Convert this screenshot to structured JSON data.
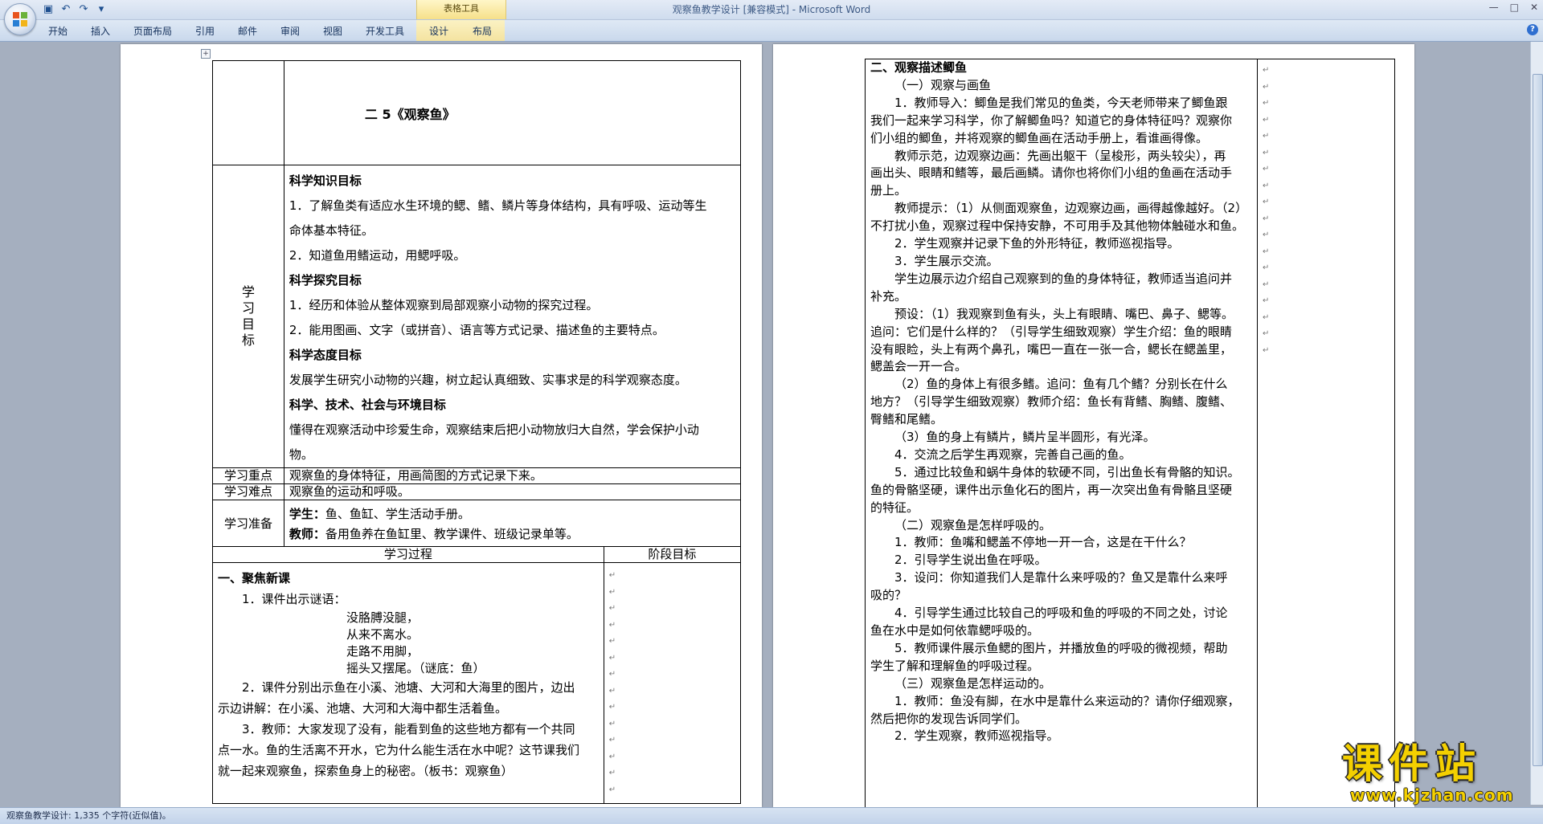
{
  "window": {
    "title": "观察鱼教学设计 [兼容模式] - Microsoft Word"
  },
  "ribbon": {
    "context_group": "表格工具",
    "tabs": [
      "开始",
      "插入",
      "页面布局",
      "引用",
      "邮件",
      "审阅",
      "视图",
      "开发工具",
      "设计",
      "布局"
    ]
  },
  "status": {
    "text": "观察鱼教学设计: 1,335 个字符(近似值)。"
  },
  "watermark": {
    "text": "课件站",
    "url": "www.kjzhan.com"
  },
  "left_page": {
    "lesson_title": "二 5《观察鱼》",
    "goals_label": [
      "学",
      "习",
      "目",
      "标"
    ],
    "goals": [
      {
        "t": "h",
        "s": "科学知识目标"
      },
      {
        "t": "p",
        "s": "1．了解鱼类有适应水生环境的鳃、鳍、鳞片等身体结构，具有呼吸、运动等生"
      },
      {
        "t": "p",
        "s": "命体基本特征。"
      },
      {
        "t": "p",
        "s": "2．知道鱼用鳍运动，用鳃呼吸。"
      },
      {
        "t": "h",
        "s": "科学探究目标"
      },
      {
        "t": "p",
        "s": "1．经历和体验从整体观察到局部观察小动物的探究过程。"
      },
      {
        "t": "p",
        "s": "2．能用图画、文字（或拼音）、语言等方式记录、描述鱼的主要特点。"
      },
      {
        "t": "h",
        "s": "科学态度目标"
      },
      {
        "t": "p",
        "s": "发展学生研究小动物的兴趣，树立起认真细致、实事求是的科学观察态度。"
      },
      {
        "t": "h",
        "s": "科学、技术、社会与环境目标"
      },
      {
        "t": "p",
        "s": "懂得在观察活动中珍爱生命，观察结束后把小动物放归大自然，学会保护小动"
      },
      {
        "t": "p",
        "s": "物。"
      }
    ],
    "key_label": "学习重点",
    "key_text": "观察鱼的身体特征，用画简图的方式记录下来。",
    "diff_label": "学习难点",
    "diff_text": "观察鱼的运动和呼吸。",
    "prep_label": "学习准备",
    "prep_student_label": "学生：",
    "prep_student": "鱼、鱼缸、学生活动手册。",
    "prep_teacher_label": "教师：",
    "prep_teacher": "备用鱼养在鱼缸里、教学课件、班级记录单等。",
    "process_header": "学习过程",
    "stage_header": "阶段目标",
    "process": [
      {
        "t": "h",
        "s": "一、聚焦新课"
      },
      {
        "t": "p",
        "s": "1．课件出示谜语："
      },
      {
        "t": "r",
        "s": "没胳膊没腿，"
      },
      {
        "t": "r",
        "s": "从来不离水。"
      },
      {
        "t": "r",
        "s": "走路不用脚，"
      },
      {
        "t": "r",
        "s": "摇头又摆尾。（谜底：鱼）"
      },
      {
        "t": "p",
        "s": "2．课件分别出示鱼在小溪、池塘、大河和大海里的图片，边出"
      },
      {
        "t": "c",
        "s": "示边讲解：在小溪、池塘、大河和大海中都生活着鱼。"
      },
      {
        "t": "p",
        "s": "3．教师：大家发现了没有，能看到鱼的这些地方都有一个共同"
      },
      {
        "t": "c",
        "s": "点一水。鱼的生活离不开水，它为什么能生活在水中呢？这节课我们"
      },
      {
        "t": "c",
        "s": "就一起来观察鱼，探索鱼身上的秘密。（板书：观察鱼）"
      }
    ]
  },
  "right_page": {
    "lines": [
      {
        "t": "h",
        "s": "二、观察描述鲫鱼"
      },
      {
        "t": "p",
        "s": "（一）观察与画鱼"
      },
      {
        "t": "p",
        "s": "1．教师导入：鲫鱼是我们常见的鱼类，今天老师带来了鲫鱼跟"
      },
      {
        "t": "c",
        "s": "我们一起来学习科学，你了解鲫鱼吗？知道它的身体特征吗？观察你"
      },
      {
        "t": "c",
        "s": "们小组的鲫鱼，并将观察的鲫鱼画在活动手册上，看谁画得像。"
      },
      {
        "t": "p",
        "s": "教师示范，边观察边画：先画出躯干（呈梭形，两头较尖），再"
      },
      {
        "t": "c",
        "s": "画出头、眼睛和鳍等，最后画鳞。请你也将你们小组的鱼画在活动手"
      },
      {
        "t": "c",
        "s": "册上。"
      },
      {
        "t": "p",
        "s": "教师提示：（1）从侧面观察鱼，边观察边画，画得越像越好。（2）"
      },
      {
        "t": "c",
        "s": "不打扰小鱼，观察过程中保持安静，不可用手及其他物体触碰水和鱼。"
      },
      {
        "t": "p",
        "s": "2．学生观察并记录下鱼的外形特征，教师巡视指导。"
      },
      {
        "t": "p",
        "s": "3．学生展示交流。"
      },
      {
        "t": "p",
        "s": "学生边展示边介绍自己观察到的鱼的身体特征，教师适当追问并"
      },
      {
        "t": "c",
        "s": "补充。"
      },
      {
        "t": "p",
        "s": "预设：（1）我观察到鱼有头，头上有眼睛、嘴巴、鼻子、鳃等。"
      },
      {
        "t": "c",
        "s": "追问：它们是什么样的？（引导学生细致观察）学生介绍：鱼的眼睛"
      },
      {
        "t": "c",
        "s": "没有眼睑，头上有两个鼻孔，嘴巴一直在一张一合，鳃长在鳃盖里，"
      },
      {
        "t": "c",
        "s": "鳃盖会一开一合。"
      },
      {
        "t": "p",
        "s": "（2）鱼的身体上有很多鳍。追问：鱼有几个鳍？分别长在什么"
      },
      {
        "t": "c",
        "s": "地方？（引导学生细致观察）教师介绍：鱼长有背鳍、胸鳍、腹鳍、"
      },
      {
        "t": "c",
        "s": "臀鳍和尾鳍。"
      },
      {
        "t": "p",
        "s": "（3）鱼的身上有鳞片，鳞片呈半圆形，有光泽。"
      },
      {
        "t": "p",
        "s": "4．交流之后学生再观察，完善自己画的鱼。"
      },
      {
        "t": "p",
        "s": "5．通过比较鱼和蜗牛身体的软硬不同，引出鱼长有骨骼的知识。"
      },
      {
        "t": "c",
        "s": "鱼的骨骼坚硬，课件出示鱼化石的图片，再一次突出鱼有骨骼且坚硬"
      },
      {
        "t": "c",
        "s": "的特征。"
      },
      {
        "t": "p",
        "s": "（二）观察鱼是怎样呼吸的。"
      },
      {
        "t": "p",
        "s": "1．教师：鱼嘴和鳃盖不停地一开一合，这是在干什么？"
      },
      {
        "t": "p",
        "s": "2．引导学生说出鱼在呼吸。"
      },
      {
        "t": "p",
        "s": "3．设问：你知道我们人是靠什么来呼吸的？鱼又是靠什么来呼"
      },
      {
        "t": "c",
        "s": "吸的？"
      },
      {
        "t": "p",
        "s": "4．引导学生通过比较自己的呼吸和鱼的呼吸的不同之处，讨论"
      },
      {
        "t": "c",
        "s": "鱼在水中是如何依靠鳃呼吸的。"
      },
      {
        "t": "p",
        "s": "5．教师课件展示鱼鳃的图片，并播放鱼的呼吸的微视频，帮助"
      },
      {
        "t": "c",
        "s": "学生了解和理解鱼的呼吸过程。"
      },
      {
        "t": "p",
        "s": "（三）观察鱼是怎样运动的。"
      },
      {
        "t": "p",
        "s": "1．教师：鱼没有脚，在水中是靠什么来运动的？请你仔细观察，"
      },
      {
        "t": "c",
        "s": "然后把你的发现告诉同学们。"
      },
      {
        "t": "p",
        "s": "2．学生观察，教师巡视指导。"
      }
    ]
  }
}
